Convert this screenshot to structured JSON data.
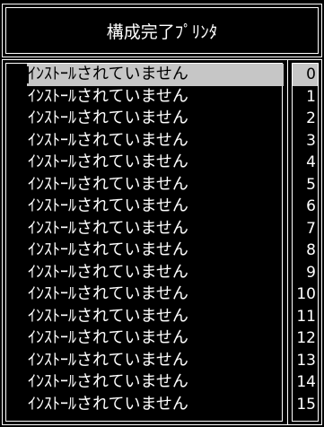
{
  "window": {
    "title": "構成完了ﾌﾟﾘﾝﾀ"
  },
  "list": {
    "selected_index": 0,
    "items": [
      {
        "status": "ｲﾝｽﾄｰﾙされていません",
        "number": "0"
      },
      {
        "status": "ｲﾝｽﾄｰﾙされていません",
        "number": "1"
      },
      {
        "status": "ｲﾝｽﾄｰﾙされていません",
        "number": "2"
      },
      {
        "status": "ｲﾝｽﾄｰﾙされていません",
        "number": "3"
      },
      {
        "status": "ｲﾝｽﾄｰﾙされていません",
        "number": "4"
      },
      {
        "status": "ｲﾝｽﾄｰﾙされていません",
        "number": "5"
      },
      {
        "status": "ｲﾝｽﾄｰﾙされていません",
        "number": "6"
      },
      {
        "status": "ｲﾝｽﾄｰﾙされていません",
        "number": "7"
      },
      {
        "status": "ｲﾝｽﾄｰﾙされていません",
        "number": "8"
      },
      {
        "status": "ｲﾝｽﾄｰﾙされていません",
        "number": "9"
      },
      {
        "status": "ｲﾝｽﾄｰﾙされていません",
        "number": "10"
      },
      {
        "status": "ｲﾝｽﾄｰﾙされていません",
        "number": "11"
      },
      {
        "status": "ｲﾝｽﾄｰﾙされていません",
        "number": "12"
      },
      {
        "status": "ｲﾝｽﾄｰﾙされていません",
        "number": "13"
      },
      {
        "status": "ｲﾝｽﾄｰﾙされていません",
        "number": "14"
      },
      {
        "status": "ｲﾝｽﾄｰﾙされていません",
        "number": "15"
      }
    ]
  },
  "colors": {
    "background": "#000000",
    "foreground": "#ffffff",
    "selection": "#c6c6c6"
  }
}
